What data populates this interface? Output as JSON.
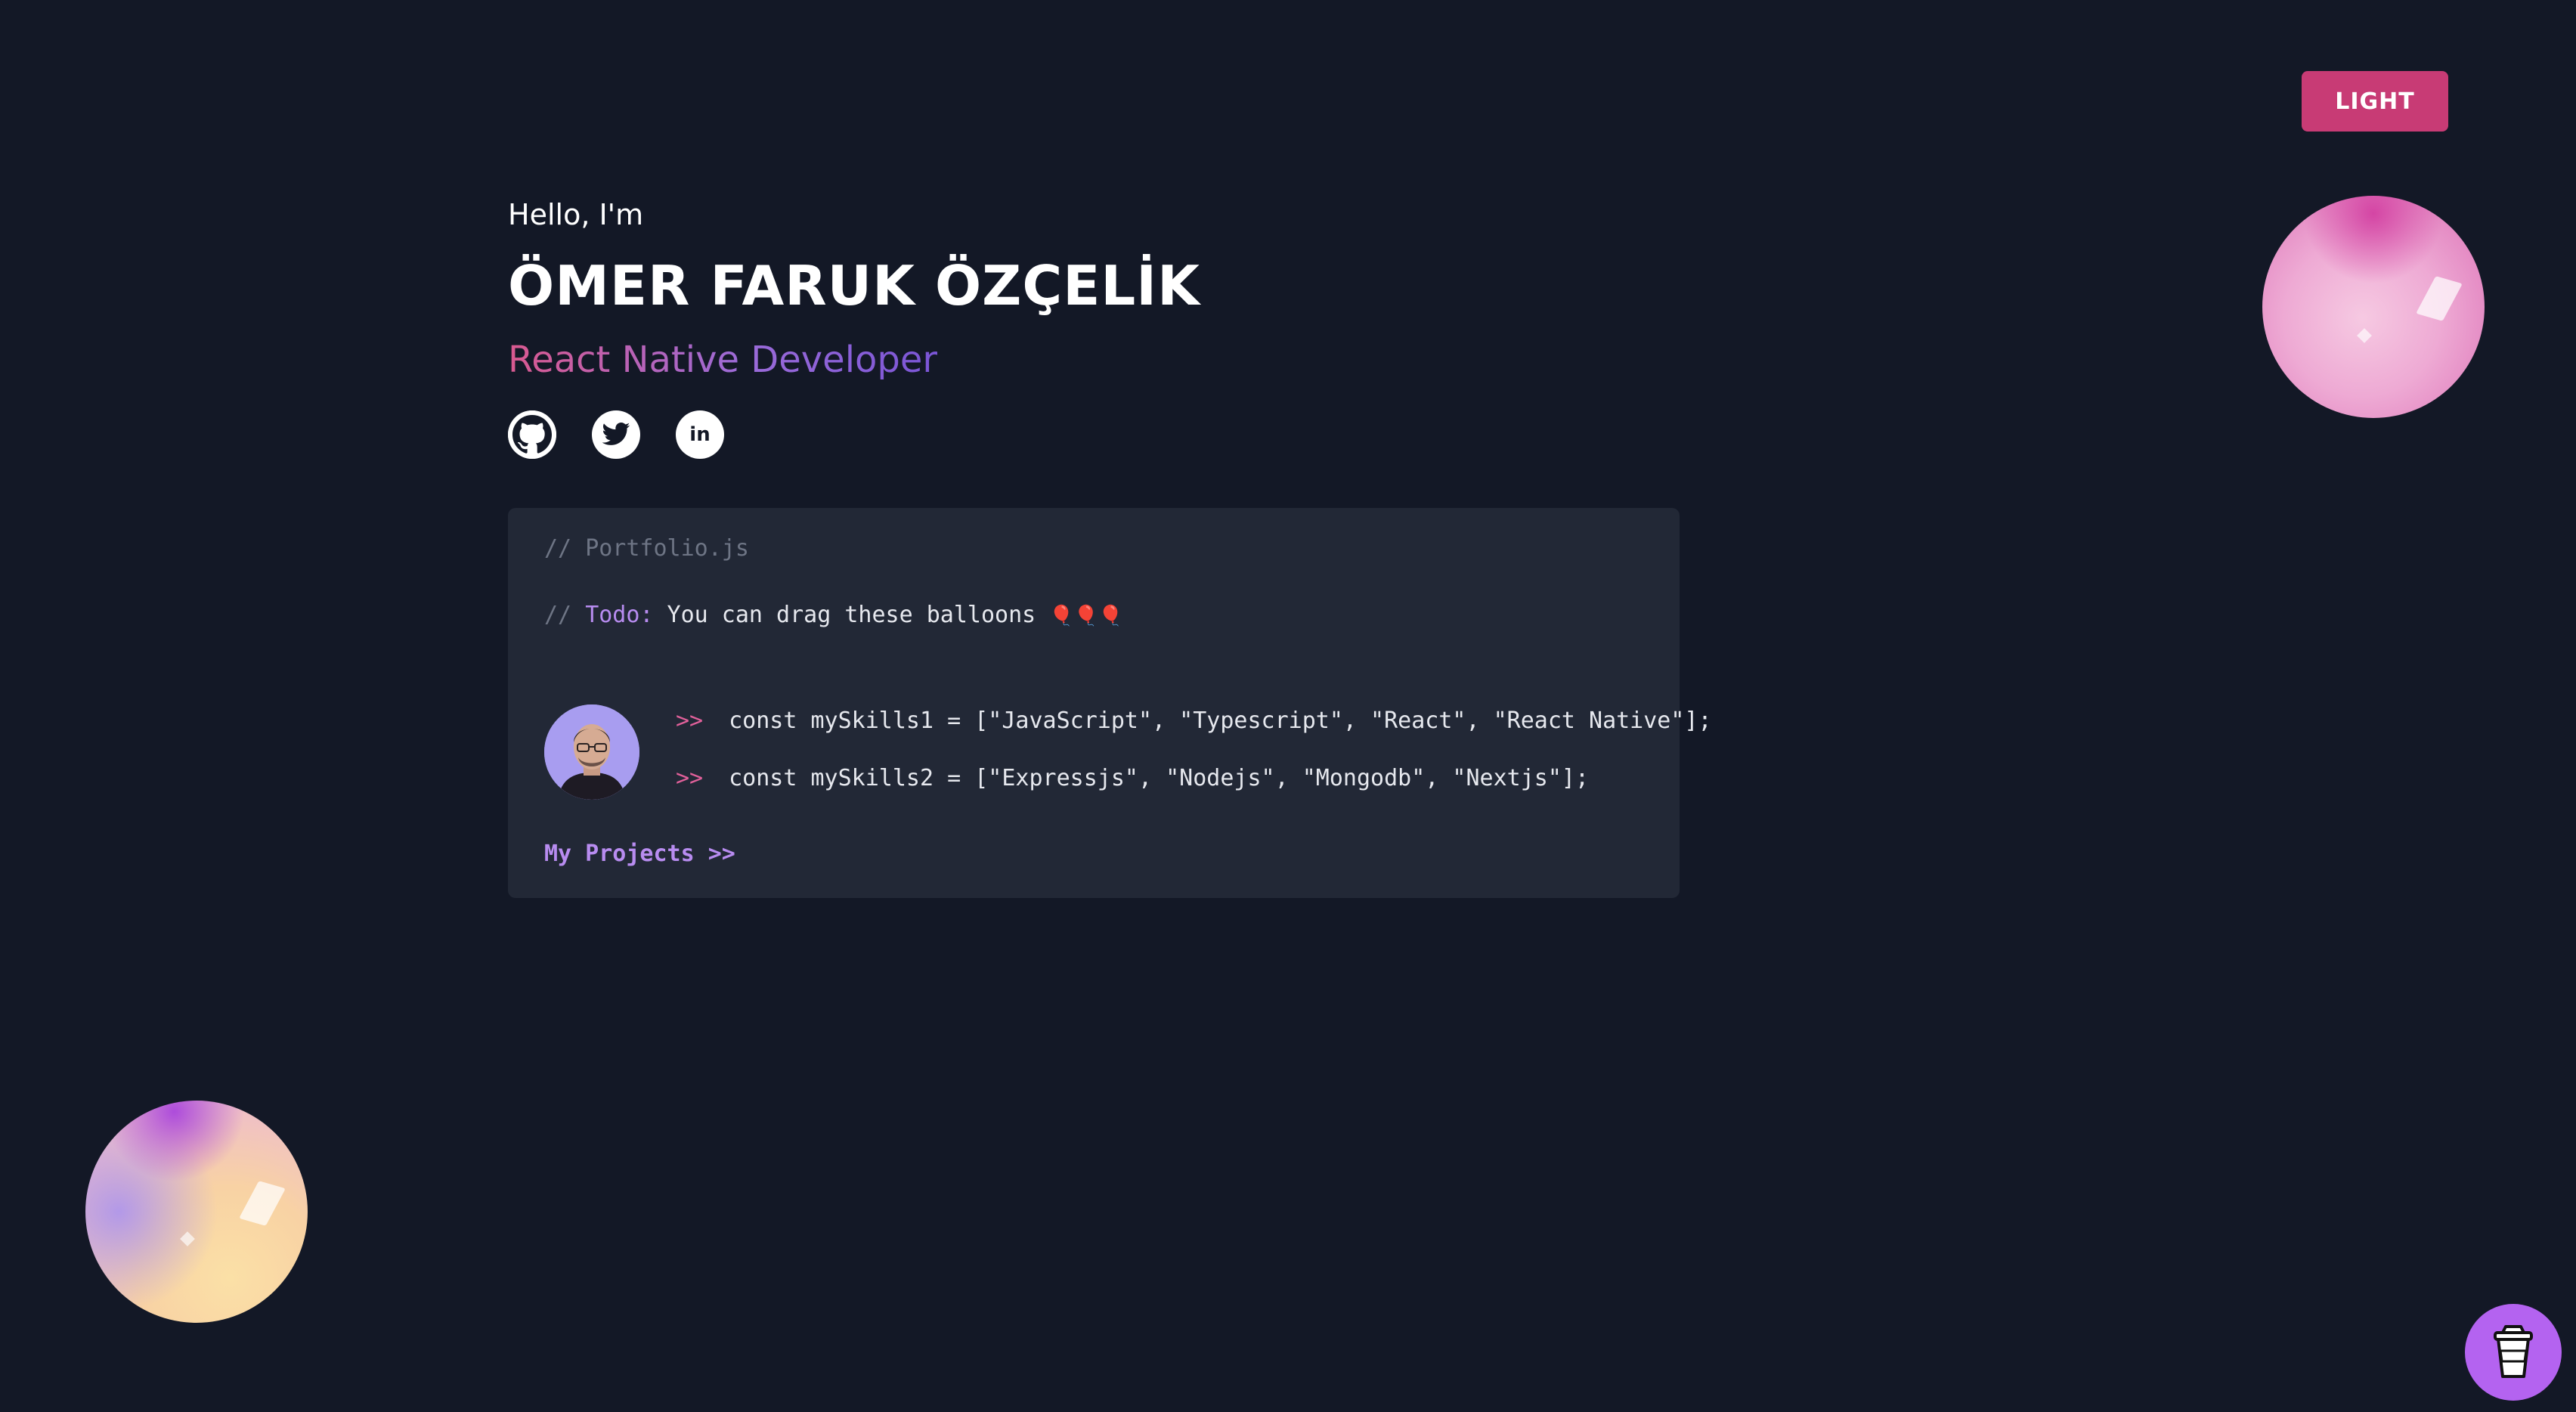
{
  "theme_toggle": {
    "label": "LIGHT"
  },
  "hero": {
    "greeting": "Hello, I'm",
    "name": "ÖMER FARUK ÖZÇELİK",
    "role": "React Native Developer"
  },
  "socials": [
    {
      "icon": "github-icon"
    },
    {
      "icon": "twitter-icon"
    },
    {
      "icon": "linkedin-icon",
      "text": "in"
    }
  ],
  "code_card": {
    "file_comment_prefix": "// ",
    "file_comment": "Portfolio.js",
    "todo_prefix": "// ",
    "todo_keyword": "Todo:",
    "todo_text": " You can drag these balloons ",
    "todo_emoji": "🎈🎈🎈",
    "prompt": ">>",
    "line1": "const mySkills1 = [\"JavaScript\", \"Typescript\", \"React\", \"React Native\"];",
    "line2": "const mySkills2 = [\"Expressjs\", \"Nodejs\", \"Mongodb\", \"Nextjs\"];",
    "projects_link": "My Projects >>"
  },
  "colors": {
    "background": "#131826",
    "card": "#222836",
    "accent_pink": "#c83b75",
    "accent_purple": "#b88cf0",
    "coffee_button": "#b463f0"
  },
  "icons": {
    "coffee": "coffee-cup-icon",
    "avatar": "avatar"
  }
}
